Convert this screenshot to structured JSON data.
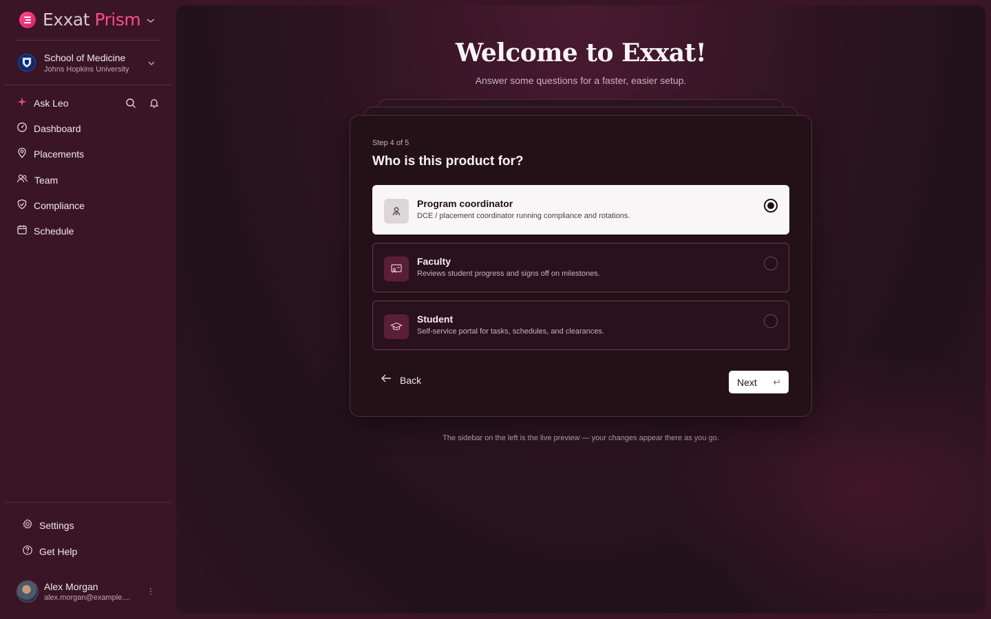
{
  "sidebar": {
    "brand": {
      "part1": "Exxat",
      "part2": "Prism"
    },
    "org": {
      "name": "School of Medicine",
      "subtitle": "Johns Hopkins University"
    },
    "nav": [
      {
        "label": "Ask Leo",
        "icon": "sparkle-icon"
      },
      {
        "label": "Dashboard",
        "icon": "gauge-icon"
      },
      {
        "label": "Placements",
        "icon": "map-pin-icon"
      },
      {
        "label": "Team",
        "icon": "users-icon"
      },
      {
        "label": "Compliance",
        "icon": "shield-check-icon"
      },
      {
        "label": "Schedule",
        "icon": "calendar-icon"
      }
    ],
    "bottom_nav": [
      {
        "label": "Settings",
        "icon": "gear-icon"
      },
      {
        "label": "Get Help",
        "icon": "help-circle-icon"
      }
    ],
    "user": {
      "name": "Alex Morgan",
      "email": "alex.morgan@example...."
    }
  },
  "main": {
    "title": "Welcome to Exxat!",
    "subtitle": "Answer some questions for a faster, easier setup.",
    "step": "Step 4 of 5",
    "question": "Who is this product for?",
    "options": [
      {
        "title": "Program coordinator",
        "description": "DCE / placement coordinator running compliance and rotations.",
        "selected": true
      },
      {
        "title": "Faculty",
        "description": "Reviews student progress and signs off on milestones.",
        "selected": false
      },
      {
        "title": "Student",
        "description": "Self-service portal for tasks, schedules, and clearances.",
        "selected": false
      }
    ],
    "back_label": "Back",
    "next_label": "Next",
    "footnote": "The sidebar on the left is the live preview — your changes appear there as you go."
  },
  "colors": {
    "accent": "#ff4b8c",
    "background": "#3a1526",
    "card": "#241118"
  }
}
